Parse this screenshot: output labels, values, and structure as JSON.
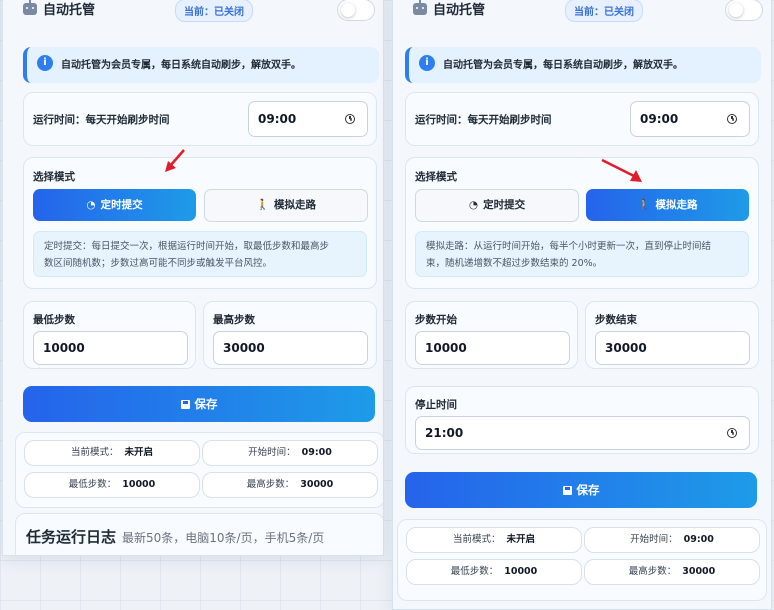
{
  "colors": {
    "accent": "#2563eb",
    "accent2": "#1e9be8",
    "arrow": "#e11d2a"
  },
  "left": {
    "title": "自动托管",
    "status": "当前：已关闭",
    "info": "自动托管为会员专属，每日系统自动刷步，解放双手。",
    "run_time_label": "运行时间：每天开始刷步时间",
    "run_time": "09:00",
    "mode_label": "选择模式",
    "mode_timed": "定时提交",
    "mode_walk": "模拟走路",
    "desc_line1": "定时提交：每日提交一次，根据运行时间开始，取最低步数和最高步",
    "desc_line2": "数区间随机数；步数过高可能不同步或触发平台风控。",
    "min_label": "最低步数",
    "min_val": "10000",
    "max_label": "最高步数",
    "max_val": "30000",
    "save": "保存",
    "stats": {
      "mode_k": "当前模式：",
      "mode_v": "未开启",
      "start_k": "开始时间：",
      "start_v": "09:00",
      "min_k": "最低步数：",
      "min_v": "10000",
      "max_k": "最高步数：",
      "max_v": "30000"
    },
    "log_title": "任务运行日志",
    "log_sub": "最新50条，电脑10条/页，手机5条/页"
  },
  "right": {
    "title": "自动托管",
    "status": "当前：已关闭",
    "info": "自动托管为会员专属，每日系统自动刷步，解放双手。",
    "run_time_label": "运行时间：每天开始刷步时间",
    "run_time": "09:00",
    "mode_label": "选择模式",
    "mode_timed": "定时提交",
    "mode_walk": "模拟走路",
    "desc_line1": "模拟走路：从运行时间开始，每半个小时更新一次，直到停止时间结",
    "desc_line2": "束，随机递增数不超过步数结束的 20%。",
    "start_label": "步数开始",
    "start_val": "10000",
    "end_label": "步数结束",
    "end_val": "30000",
    "stop_label": "停止时间",
    "stop_val": "21:00",
    "save": "保存",
    "stats": {
      "mode_k": "当前模式：",
      "mode_v": "未开启",
      "start_k": "开始时间：",
      "start_v": "09:00",
      "min_k": "最低步数：",
      "min_v": "10000",
      "max_k": "最高步数：",
      "max_v": "30000"
    }
  }
}
